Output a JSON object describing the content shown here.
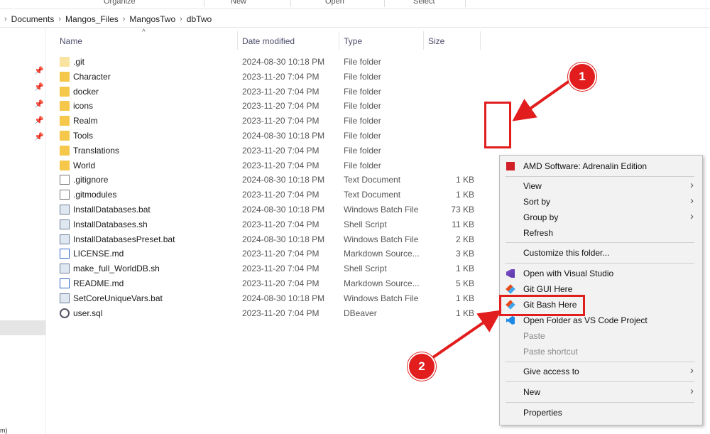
{
  "ribbon": {
    "groups": [
      "Organize",
      "New",
      "Open",
      "Select"
    ]
  },
  "breadcrumb": [
    "Documents",
    "Mangos_Files",
    "MangosTwo",
    "dbTwo"
  ],
  "columns": {
    "name": "Name",
    "date": "Date modified",
    "type": "Type",
    "size": "Size"
  },
  "files": [
    {
      "name": ".git",
      "date": "2024-08-30 10:18 PM",
      "type": "File folder",
      "size": "",
      "icon": "folder-light-icon"
    },
    {
      "name": "Character",
      "date": "2023-11-20 7:04 PM",
      "type": "File folder",
      "size": "",
      "icon": "folder-icon"
    },
    {
      "name": "docker",
      "date": "2023-11-20 7:04 PM",
      "type": "File folder",
      "size": "",
      "icon": "folder-icon"
    },
    {
      "name": "icons",
      "date": "2023-11-20 7:04 PM",
      "type": "File folder",
      "size": "",
      "icon": "folder-icon"
    },
    {
      "name": "Realm",
      "date": "2023-11-20 7:04 PM",
      "type": "File folder",
      "size": "",
      "icon": "folder-icon"
    },
    {
      "name": "Tools",
      "date": "2024-08-30 10:18 PM",
      "type": "File folder",
      "size": "",
      "icon": "folder-icon"
    },
    {
      "name": "Translations",
      "date": "2023-11-20 7:04 PM",
      "type": "File folder",
      "size": "",
      "icon": "folder-icon"
    },
    {
      "name": "World",
      "date": "2023-11-20 7:04 PM",
      "type": "File folder",
      "size": "",
      "icon": "folder-icon"
    },
    {
      "name": ".gitignore",
      "date": "2024-08-30 10:18 PM",
      "type": "Text Document",
      "size": "1 KB",
      "icon": "text-file-icon"
    },
    {
      "name": ".gitmodules",
      "date": "2023-11-20 7:04 PM",
      "type": "Text Document",
      "size": "1 KB",
      "icon": "text-file-icon"
    },
    {
      "name": "InstallDatabases.bat",
      "date": "2024-08-30 10:18 PM",
      "type": "Windows Batch File",
      "size": "73 KB",
      "icon": "batch-file-icon"
    },
    {
      "name": "InstallDatabases.sh",
      "date": "2023-11-20 7:04 PM",
      "type": "Shell Script",
      "size": "11 KB",
      "icon": "batch-file-icon"
    },
    {
      "name": "InstallDatabasesPreset.bat",
      "date": "2024-08-30 10:18 PM",
      "type": "Windows Batch File",
      "size": "2 KB",
      "icon": "batch-file-icon"
    },
    {
      "name": "LICENSE.md",
      "date": "2023-11-20 7:04 PM",
      "type": "Markdown Source...",
      "size": "3 KB",
      "icon": "markdown-file-icon"
    },
    {
      "name": "make_full_WorldDB.sh",
      "date": "2023-11-20 7:04 PM",
      "type": "Shell Script",
      "size": "1 KB",
      "icon": "batch-file-icon"
    },
    {
      "name": "README.md",
      "date": "2023-11-20 7:04 PM",
      "type": "Markdown Source...",
      "size": "5 KB",
      "icon": "markdown-file-icon"
    },
    {
      "name": "SetCoreUniqueVars.bat",
      "date": "2024-08-30 10:18 PM",
      "type": "Windows Batch File",
      "size": "1 KB",
      "icon": "batch-file-icon"
    },
    {
      "name": "user.sql",
      "date": "2023-11-20 7:04 PM",
      "type": "DBeaver",
      "size": "1 KB",
      "icon": "dbeaver-icon"
    }
  ],
  "context_menu": {
    "amd": "AMD Software: Adrenalin Edition",
    "view": "View",
    "sort_by": "Sort by",
    "group_by": "Group by",
    "refresh": "Refresh",
    "customize": "Customize this folder...",
    "open_vs": "Open with Visual Studio",
    "git_gui": "Git GUI Here",
    "git_bash": "Git Bash Here",
    "open_vscode": "Open Folder as VS Code Project",
    "paste": "Paste",
    "paste_shortcut": "Paste shortcut",
    "give_access": "Give access to",
    "new": "New",
    "properties": "Properties"
  },
  "annotations": {
    "step1": "1",
    "step2": "2",
    "color": "#e11d1d"
  },
  "status_fragment": "m)"
}
